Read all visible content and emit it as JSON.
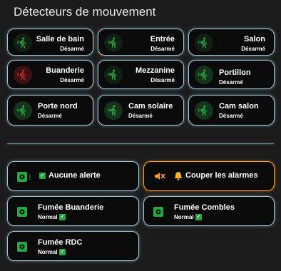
{
  "title": "Détecteurs de mouvement",
  "motion": [
    {
      "name": "Salle de bain",
      "state": "Désarmé",
      "icon": "motion-walk-icon"
    },
    {
      "name": "Entrée",
      "state": "Désarmé",
      "icon": "motion-walk-icon"
    },
    {
      "name": "Salon",
      "state": "Désarmé",
      "icon": "motion-walk-icon"
    },
    {
      "name": "Buanderie",
      "state": "Désarmé",
      "icon": "motion-walk-icon"
    },
    {
      "name": "Mezzanine",
      "state": "Désarmé",
      "icon": "motion-walk-icon"
    },
    {
      "name": "Portillon",
      "state": "Désarmé",
      "icon": "motion-walk-icon"
    },
    {
      "name": "Porte nord",
      "state": "Désarmé",
      "icon": "motion-walk-icon"
    },
    {
      "name": "Cam solaire",
      "state": "Désarmé",
      "icon": "motion-walk-icon"
    },
    {
      "name": "Cam salon",
      "state": "Désarmé",
      "icon": "motion-walk-icon"
    }
  ],
  "alerts": {
    "status_label": "Aucune alerte",
    "mute_label": "Couper les alarmes"
  },
  "smoke": [
    {
      "name": "Fumée Buanderie",
      "state": "Normal"
    },
    {
      "name": "Fumée Combles",
      "state": "Normal"
    },
    {
      "name": "Fumée RDC",
      "state": "Normal"
    }
  ],
  "colors": {
    "accent_green": "#27a844",
    "alert_red": "#c0282c",
    "warn_orange": "#ff9f1a",
    "border_glow": "#9fc7d6"
  }
}
